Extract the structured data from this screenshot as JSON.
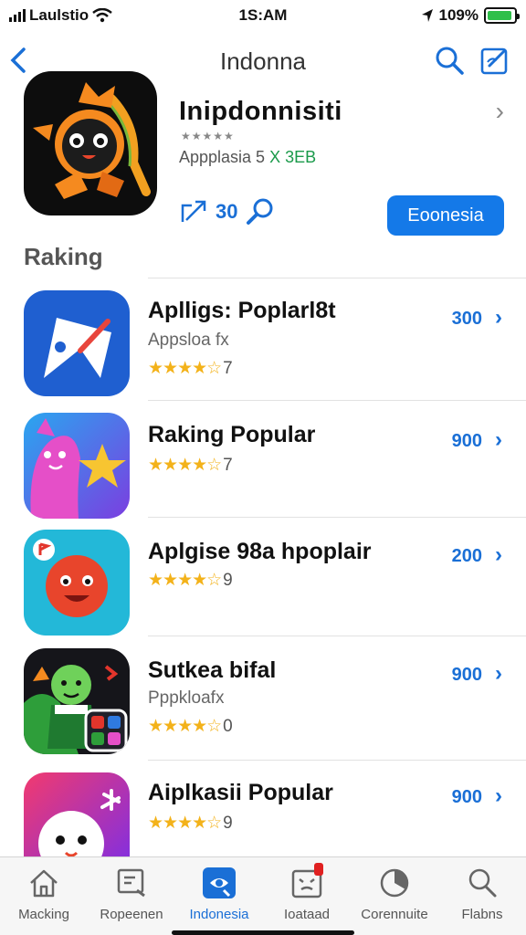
{
  "status": {
    "carrier": "Laulstio",
    "time": "1S:AM",
    "battery": "109%",
    "battery_fill": 0.92
  },
  "nav": {
    "title": "Indonna"
  },
  "featured": {
    "title": "Inipdonnisiti",
    "stars": "★★★★★",
    "subtitle_prefix": "Appplasia 5",
    "subtitle_green": "X 3EB",
    "action_count": "30",
    "button_label": "Eoonesia"
  },
  "section": {
    "title": "Raking"
  },
  "apps": [
    {
      "name": "Aplligs:  Poplarl8t",
      "subtitle": "Appsloa fx",
      "stars": "★★★★☆",
      "rating": "7",
      "price": "300"
    },
    {
      "name": "Raking Popular",
      "subtitle": "",
      "stars": "★★★★☆",
      "rating": "7",
      "price": "900"
    },
    {
      "name": "Aplgise 98a hpoplair",
      "subtitle": "",
      "stars": "★★★★☆",
      "rating": "9",
      "price": "200"
    },
    {
      "name": "Sutkea bifal",
      "subtitle": "Pppkloafx",
      "stars": "★★★★☆",
      "rating": "0",
      "price": "900"
    },
    {
      "name": "Aiplkasii Popular",
      "subtitle": "",
      "stars": "★★★★☆",
      "rating": "9",
      "price": "900"
    }
  ],
  "tabs": [
    {
      "label": "Macking",
      "icon": "home-icon"
    },
    {
      "label": "Ropeenen",
      "icon": "screen-search-icon"
    },
    {
      "label": "Indonesia",
      "icon": "indonesia-tab-icon",
      "active": true
    },
    {
      "label": "Ioataad",
      "icon": "face-box-icon",
      "badge": true
    },
    {
      "label": "Corennuite",
      "icon": "pie-icon"
    },
    {
      "label": "Flabns",
      "icon": "search-icon"
    }
  ],
  "colors": {
    "accent": "#1a6fd6",
    "button": "#1479e8",
    "star": "#f3b21a",
    "battery": "#2fbf4a"
  }
}
